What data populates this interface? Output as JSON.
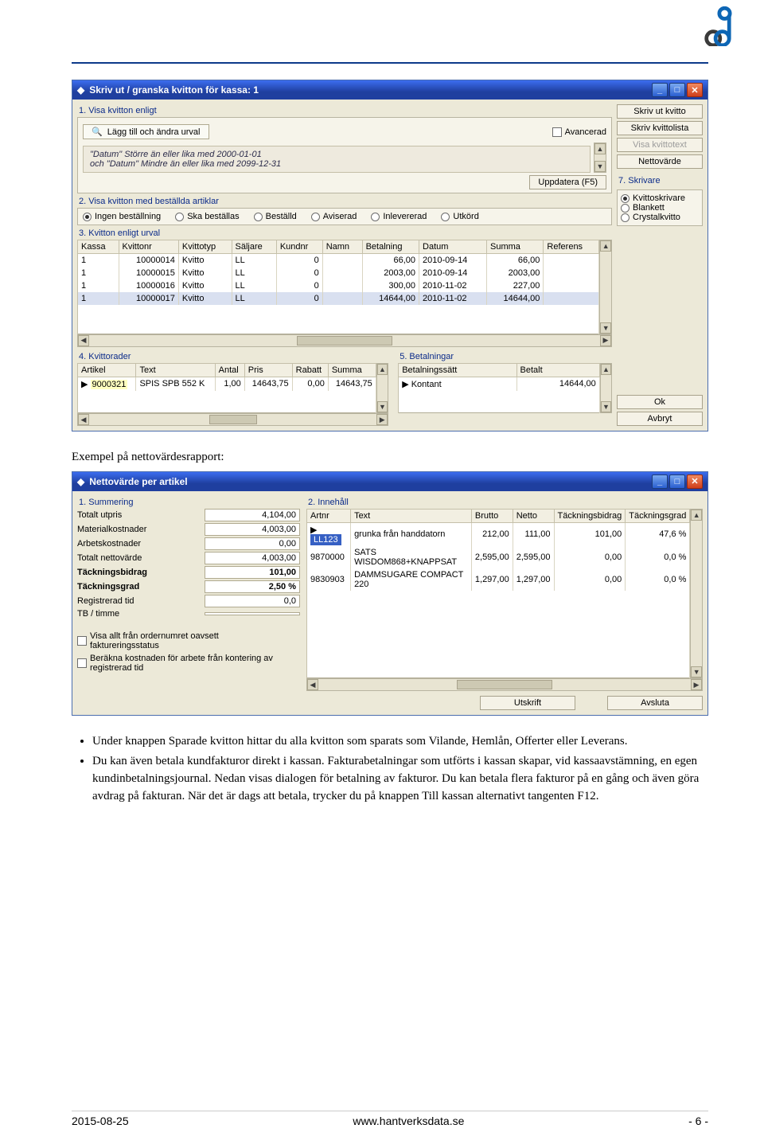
{
  "header": {},
  "window1": {
    "title": "Skriv ut / granska kvitton för kassa: 1",
    "section1_label": "1. Visa kvitton enligt",
    "urval_button": "Lägg till och ändra urval",
    "criteria_line1": "\"Datum\" Större än eller lika med 2000-01-01",
    "criteria_line2": "och \"Datum\" Mindre än eller lika med 2099-12-31",
    "avancerad_label": "Avancerad",
    "uppdatera_label": "Uppdatera (F5)",
    "section2_label": "2. Visa kvitton med beställda artiklar",
    "orderstatus": [
      "Ingen beställning",
      "Ska beställas",
      "Beställd",
      "Aviserad",
      "Inlevererad",
      "Utkörd"
    ],
    "section3_label": "3. Kvitton enligt urval",
    "kvitton_headers": [
      "Kassa",
      "Kvittonr",
      "Kvittotyp",
      "Säljare",
      "Kundnr",
      "Namn",
      "Betalning",
      "Datum",
      "Summa",
      "Referens"
    ],
    "kvitton_rows": [
      {
        "kassa": "1",
        "nr": "10000014",
        "typ": "Kvitto",
        "salj": "LL",
        "kund": "0",
        "namn": "",
        "bet": "66,00",
        "datum": "2010-09-14",
        "summa": "66,00",
        "ref": ""
      },
      {
        "kassa": "1",
        "nr": "10000015",
        "typ": "Kvitto",
        "salj": "LL",
        "kund": "0",
        "namn": "",
        "bet": "2003,00",
        "datum": "2010-09-14",
        "summa": "2003,00",
        "ref": ""
      },
      {
        "kassa": "1",
        "nr": "10000016",
        "typ": "Kvitto",
        "salj": "LL",
        "kund": "0",
        "namn": "",
        "bet": "300,00",
        "datum": "2010-11-02",
        "summa": "227,00",
        "ref": ""
      },
      {
        "kassa": "1",
        "nr": "10000017",
        "typ": "Kvitto",
        "salj": "LL",
        "kund": "0",
        "namn": "",
        "bet": "14644,00",
        "datum": "2010-11-02",
        "summa": "14644,00",
        "ref": ""
      }
    ],
    "section4_label": "4. Kvittorader",
    "rader_headers": [
      "Artikel",
      "Text",
      "Antal",
      "Pris",
      "Rabatt",
      "Summa"
    ],
    "rader_row": {
      "art": "9000321",
      "text": "SPIS SPB 552 K",
      "antal": "1,00",
      "pris": "14643,75",
      "rabatt": "0,00",
      "summa": "14643,75"
    },
    "section5_label": "5. Betalningar",
    "bet_headers": [
      "Betalningssätt",
      "Betalt"
    ],
    "bet_row": {
      "satt": "Kontant",
      "belopp": "14644,00"
    },
    "side_buttons": {
      "skriv_ut": "Skriv ut kvitto",
      "skriv_lista": "Skriv kvittolista",
      "visa_text": "Visa kvittotext",
      "nettovarde": "Nettovärde",
      "skrivare_label": "7. Skrivare",
      "skrivare_opts": [
        "Kvittoskrivare",
        "Blankett",
        "Crystalkvitto"
      ],
      "ok": "Ok",
      "avbryt": "Avbryt"
    }
  },
  "caption1": "Exempel på nettovärdesrapport:",
  "window2": {
    "title": "Nettovärde per artikel",
    "section_sum": "1. Summering",
    "section_inn": "2. Innehåll",
    "summary": [
      {
        "label": "Totalt utpris",
        "val": "4,104,00"
      },
      {
        "label": "Materialkostnader",
        "val": "4,003,00"
      },
      {
        "label": "Arbetskostnader",
        "val": "0,00"
      },
      {
        "label": "Totalt nettovärde",
        "val": "4,003,00"
      },
      {
        "label": "Täckningsbidrag",
        "val": "101,00",
        "bold": true
      },
      {
        "label": "Täckningsgrad",
        "val": "2,50 %",
        "bold": true
      },
      {
        "label": "Registrerad tid",
        "val": "0,0"
      },
      {
        "label": "TB / timme",
        "val": ""
      }
    ],
    "chk1": "Visa allt från ordernumret oavsett faktureringsstatus",
    "chk2": "Beräkna kostnaden för arbete från kontering av registrerad tid",
    "inn_headers": [
      "Artnr",
      "Text",
      "Brutto",
      "Netto",
      "Täckningsbidrag",
      "Täckningsgrad"
    ],
    "inn_rows": [
      {
        "art": "LL123",
        "text": "grunka från handdatorn",
        "brutto": "212,00",
        "netto": "111,00",
        "tb": "101,00",
        "tg": "47,6 %",
        "hl": true
      },
      {
        "art": "9870000",
        "text": "SATS WISDOM868+KNAPPSAT",
        "brutto": "2,595,00",
        "netto": "2,595,00",
        "tb": "0,00",
        "tg": "0,0 %"
      },
      {
        "art": "9830903",
        "text": "DAMMSUGARE COMPACT 220",
        "brutto": "1,297,00",
        "netto": "1,297,00",
        "tb": "0,00",
        "tg": "0,0 %"
      }
    ],
    "utskrift": "Utskrift",
    "avsluta": "Avsluta"
  },
  "bullets": [
    "Under knappen Sparade kvitton hittar du alla kvitton som sparats som Vilande, Hemlån, Offerter eller Leverans.",
    "Du kan även betala kundfakturor direkt i kassan. Fakturabetalningar som utförts i kassan skapar, vid kassaavstämning, en egen kundinbetalningsjournal. Nedan visas dialogen för betalning av fakturor. Du kan betala flera fakturor på en gång och även göra avdrag på fakturan. När det är dags att betala, trycker du på knappen Till kassan alternativt tangenten F12."
  ],
  "footer": {
    "date": "2015-08-25",
    "url": "www.hantverksdata.se",
    "page": "- 6 -"
  }
}
